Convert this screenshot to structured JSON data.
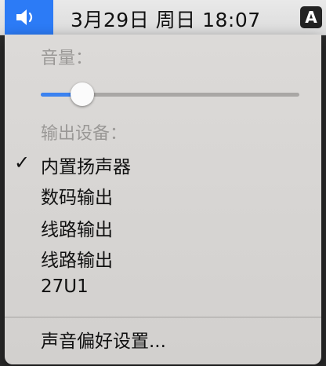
{
  "menubar": {
    "clock": "3月29日 周日  18:07",
    "input_source": "A"
  },
  "volume_menu": {
    "volume_label": "音量：",
    "volume_level": 0.16,
    "output_label": "输出设备：",
    "devices": [
      {
        "label": "内置扬声器",
        "selected": true,
        "check": "✓"
      },
      {
        "label": "数码输出",
        "selected": false,
        "check": ""
      },
      {
        "label": "线路输出",
        "selected": false,
        "check": ""
      },
      {
        "label": "线路输出",
        "selected": false,
        "check": ""
      },
      {
        "label": "27U1",
        "selected": false,
        "check": ""
      }
    ],
    "preferences_label": "声音偏好设置..."
  }
}
